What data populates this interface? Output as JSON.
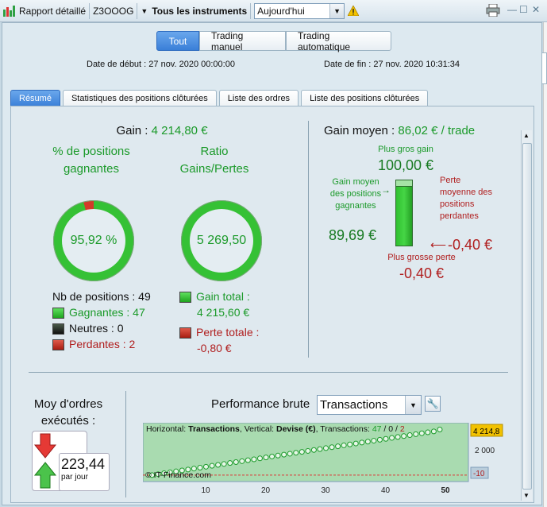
{
  "toolbar": {
    "report_label": "Rapport détaillé",
    "account": "Z3OOOG",
    "instruments": "Tous les instruments",
    "period": "Aujourd'hui"
  },
  "segments": [
    "Tout",
    "Trading manuel",
    "Trading automatique"
  ],
  "dates": {
    "start_label": "Date de début : 27 nov. 2020 00:00:00",
    "end_label": "Date de fin : 27 nov. 2020 10:31:34"
  },
  "tabs": [
    "Résumé",
    "Statistiques des positions clôturées",
    "Liste des ordres",
    "Liste des positions clôturées"
  ],
  "summary": {
    "gain_label": "Gain :",
    "gain_value": "4 214,80 €",
    "pct_title": "% de positions gagnantes",
    "pct_value": "95,92 %",
    "pct_fraction": 0.9592,
    "ratio_title": "Ratio Gains/Pertes",
    "ratio_value": "5 269,50",
    "ratio_fraction": 0.9998,
    "nb_positions": "Nb de positions : 49",
    "winners": "Gagnantes : 47",
    "neutral": "Neutres : 0",
    "losers": "Perdantes : 2",
    "gain_total_label": "Gain total :",
    "gain_total_value": "4 215,60 €",
    "perte_totale_label": "Perte totale :",
    "perte_totale_value": "-0,80 €"
  },
  "avg": {
    "gain_moyen_label": "Gain moyen :",
    "gain_moyen_value": "86,02 € / trade",
    "plus_gros_gain_label": "Plus gros gain",
    "plus_gros_gain_value": "100,00 €",
    "gain_moyen_pos_label": "Gain moyen des positions gagnantes",
    "gain_moyen_pos_value": "89,69 €",
    "perte_moyenne_label": "Perte moyenne des positions perdantes",
    "perte_moyenne_value": "-0,40 €",
    "plus_grosse_perte_label": "Plus grosse perte",
    "plus_grosse_perte_value": "-0,40 €"
  },
  "orders": {
    "title": "Moy d'ordres exécutés :",
    "value": "223,44",
    "unit": "par jour"
  },
  "performance": {
    "title": "Performance brute",
    "mode": "Transactions",
    "info_prefix": "Horizontal: ",
    "info_h": "Transactions",
    "info_mid": ", Vertical: ",
    "info_v": "Devise (€)",
    "info_suffix": ", Transactions: ",
    "info_win": "47",
    "info_sep1": " / ",
    "info_neutral": "0",
    "info_sep2": " / ",
    "info_lose": "2",
    "watermark": "© IT-Finance.com",
    "last_value_label": "4 214,8",
    "y_tick_2000": "2 000",
    "y_tick_neg": "-10",
    "x_ticks": [
      "10",
      "20",
      "30",
      "40",
      "50"
    ]
  },
  "chart_data": {
    "type": "scatter",
    "xlabel": "Transactions",
    "ylabel": "Devise (€)",
    "xlim": [
      0,
      55
    ],
    "ylim": [
      -10,
      4400
    ],
    "x": [
      1,
      2,
      3,
      4,
      5,
      6,
      7,
      8,
      9,
      10,
      11,
      12,
      13,
      14,
      15,
      16,
      17,
      18,
      19,
      20,
      21,
      22,
      23,
      24,
      25,
      26,
      27,
      28,
      29,
      30,
      31,
      32,
      33,
      34,
      35,
      36,
      37,
      38,
      39,
      40,
      41,
      42,
      43,
      44,
      45,
      46,
      47,
      48,
      49
    ],
    "y": [
      -0.4,
      86,
      172,
      258,
      344,
      430,
      516,
      602,
      688,
      774,
      860,
      946,
      1032,
      1118,
      1204,
      1290,
      1376,
      1462,
      1548,
      1634,
      1720,
      1806,
      1892,
      1978,
      2064,
      2150,
      2236,
      2322,
      2408,
      2494,
      2580,
      2666,
      2752,
      2838,
      2924,
      3010,
      3096,
      3182,
      3268,
      3354,
      3440,
      3526,
      3612,
      3698,
      3784,
      3870,
      3956,
      4042,
      4214.8
    ],
    "colors": {
      "series": "#1b9a2a",
      "panel": "#a9dbb0"
    }
  },
  "colors": {
    "accent": "#3a7fd8",
    "green": "#1b9a2a",
    "red": "#b01e1e"
  }
}
